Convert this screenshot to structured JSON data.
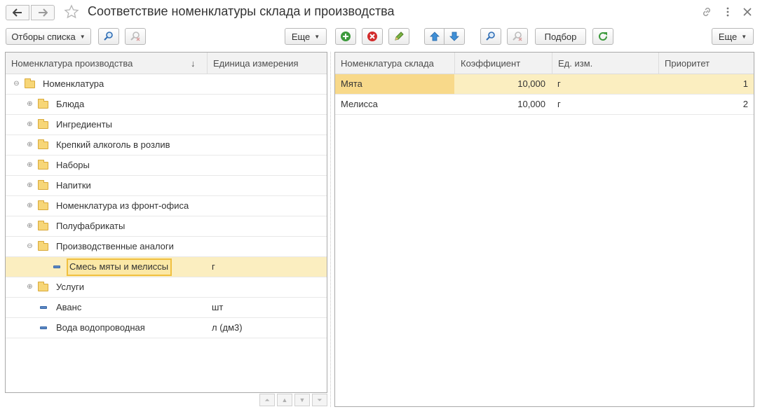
{
  "window": {
    "title": "Соответствие номенклатуры склада и производства",
    "back_icon": "arrow-left-icon",
    "forward_icon": "arrow-right-icon",
    "favorite_icon": "star-icon",
    "link_icon": "link-icon",
    "menu_icon": "more-vertical-icon",
    "close_icon": "close-icon"
  },
  "left_toolbar": {
    "filters_label": "Отборы списка",
    "more_label": "Еще"
  },
  "right_toolbar": {
    "selection_label": "Подбор",
    "more_label": "Еще"
  },
  "left_table": {
    "columns": [
      "Номенклатура производства",
      "Единица измерения"
    ],
    "sort_indicator": "↓",
    "rows": [
      {
        "name": "Номенклатура",
        "unit": "",
        "kind": "group",
        "expanded": true
      },
      {
        "name": "Блюда",
        "unit": "",
        "kind": "group",
        "expanded": false
      },
      {
        "name": "Ингредиенты",
        "unit": "",
        "kind": "group",
        "expanded": false
      },
      {
        "name": "Крепкий алкоголь в розлив",
        "unit": "",
        "kind": "group",
        "expanded": false
      },
      {
        "name": "Наборы",
        "unit": "",
        "kind": "group",
        "expanded": false
      },
      {
        "name": "Напитки",
        "unit": "",
        "kind": "group",
        "expanded": false
      },
      {
        "name": "Номенклатура из фронт-офиса",
        "unit": "",
        "kind": "group",
        "expanded": false
      },
      {
        "name": "Полуфабрикаты",
        "unit": "",
        "kind": "group",
        "expanded": false
      },
      {
        "name": "Производственные аналоги",
        "unit": "",
        "kind": "group",
        "expanded": true
      },
      {
        "name": "Смесь мяты и мелиссы",
        "unit": "г",
        "kind": "item",
        "selected": true
      },
      {
        "name": "Услуги",
        "unit": "",
        "kind": "group",
        "expanded": false
      },
      {
        "name": "Аванс",
        "unit": "шт",
        "kind": "item"
      },
      {
        "name": "Вода водопроводная",
        "unit": "л (дм3)",
        "kind": "item"
      }
    ]
  },
  "right_table": {
    "columns": [
      "Номенклатура склада",
      "Коэффициент",
      "Ед. изм.",
      "Приоритет"
    ],
    "rows": [
      {
        "name": "Мята",
        "coef": "10,000",
        "unit": "г",
        "priority": "1",
        "selected": true
      },
      {
        "name": "Мелисса",
        "coef": "10,000",
        "unit": "г",
        "priority": "2"
      }
    ]
  },
  "colors": {
    "selection": "#fbeec0",
    "focus_border": "#f0c040",
    "header_bg": "#f2f2f2",
    "add_green": "#3c9a3c",
    "delete_red": "#d22b2b",
    "arrow_blue": "#3f8fd6"
  }
}
